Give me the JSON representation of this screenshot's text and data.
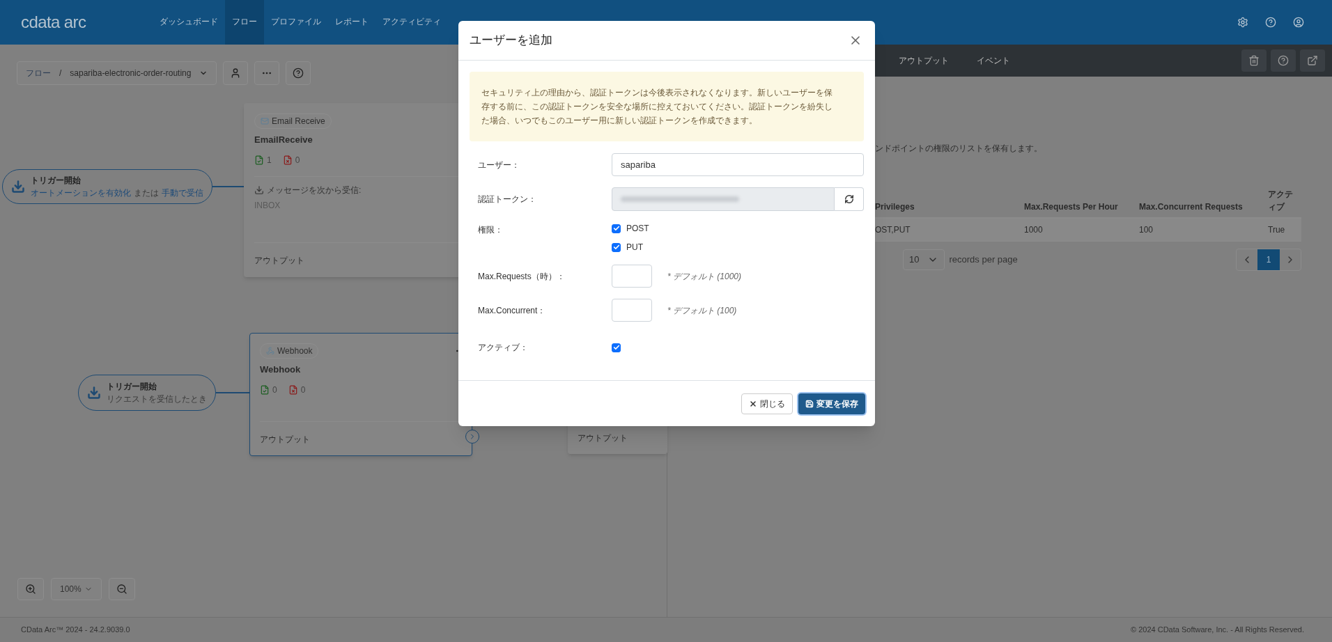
{
  "header": {
    "logo": "cdata arc",
    "nav": [
      {
        "label": "ダッシュボード",
        "selected": false
      },
      {
        "label": "フロー",
        "selected": true
      },
      {
        "label": "プロファイル",
        "selected": false
      },
      {
        "label": "レポート",
        "selected": false
      },
      {
        "label": "アクティビティ",
        "selected": false
      }
    ]
  },
  "toolbar": {
    "root": "フロー",
    "separator": "/",
    "flow": "sapariba-electronic-order-routing"
  },
  "canvas": {
    "triggers": [
      {
        "title": "トリガー開始",
        "parts": [
          {
            "kind": "link",
            "text": "オートメーションを有効化"
          },
          {
            "kind": "text",
            "text": "または"
          },
          {
            "kind": "link",
            "text": "手動で受信"
          }
        ]
      },
      {
        "title": "トリガー開始",
        "parts": [
          {
            "kind": "text",
            "text": "リクエストを受信したとき"
          }
        ]
      }
    ],
    "cards": [
      {
        "kind": "email",
        "badge": "Email Receive",
        "name": "EmailReceive",
        "success": "1",
        "error": "0",
        "receive_label": "メッセージを次から受信:",
        "receive_value": "INBOX",
        "output": "アウトプット",
        "selected": false
      },
      {
        "kind": "webhook",
        "badge": "Webhook",
        "name": "Webhook",
        "success": "0",
        "error": "0",
        "output": "アウトプット",
        "selected": true
      }
    ],
    "partial_card": {
      "output": "アウトプット"
    },
    "zoom": "100%"
  },
  "right_panel": {
    "tabs": [
      "アウトプット",
      "イベント"
    ],
    "description": "ンドポイントの権限のリストを保有します。",
    "table": {
      "columns": [
        "Privileges",
        "Max.Requests Per Hour",
        "Max.Concurrent Requests",
        "アクティブ"
      ],
      "rows": [
        [
          "OST,PUT",
          "1000",
          "100",
          "True"
        ]
      ]
    },
    "page_size": "10",
    "page_size_label": "records per page",
    "pages": [
      {
        "label": "1",
        "selected": true
      }
    ]
  },
  "modal": {
    "title": "ユーザーを追加",
    "notice": "セキュリティ上の理由から、認証トークンは今後表示されなくなります。新しいユーザーを保存する前に、この認証トークンを安全な場所に控えておいてください。認証トークンを紛失した場合、いつでもこのユーザー用に新しい認証トークンを作成できます。",
    "user_label": "ユーザー：",
    "user_value": "sapariba",
    "token_label": "認証トークン：",
    "privileges_label": "権限：",
    "privileges": [
      {
        "label": "POST",
        "checked": true
      },
      {
        "label": "PUT",
        "checked": true
      }
    ],
    "max_requests_label": "Max.Requests（時）：",
    "max_requests_hint": "* デフォルト (1000)",
    "max_concurrent_label": "Max.Concurrent：",
    "max_concurrent_hint": "* デフォルト (100)",
    "active_label": "アクティブ：",
    "active": true,
    "close_button": "閉じる",
    "save_button": "変更を保存"
  },
  "footer": {
    "left": "CData Arc™ 2024 - 24.2.9039.0",
    "right": "© 2024 CData Software, Inc. - All Rights Reserved."
  }
}
